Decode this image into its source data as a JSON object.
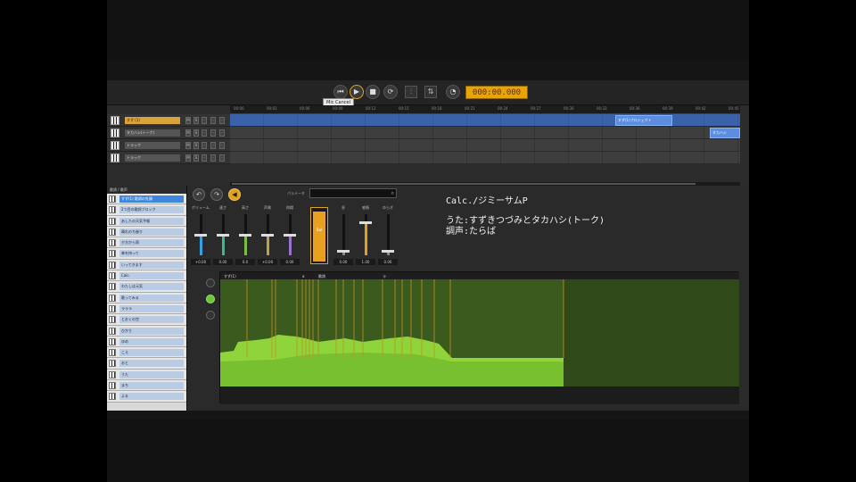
{
  "transport": {
    "tooltip": "Mic Cancel",
    "timecode": "000:00.000"
  },
  "tracks": {
    "ruler_ticks": [
      "00:00",
      "00:03",
      "00:06",
      "00:09",
      "00:12",
      "00:15",
      "00:18",
      "00:21",
      "00:24",
      "00:27",
      "00:30",
      "00:33",
      "00:36",
      "00:39",
      "00:42",
      "00:45"
    ],
    "rows": [
      {
        "name": "すず (1)",
        "selected": true
      },
      {
        "name": "タカハシ(トーク)",
        "selected": false
      },
      {
        "name": "トラック",
        "selected": false
      },
      {
        "name": "トラック",
        "selected": false
      }
    ],
    "clips": [
      {
        "label": "すず(1)プロジェクト",
        "track": 0
      },
      {
        "label": "タカハシ",
        "track": 1
      }
    ]
  },
  "lyrics": {
    "header": "歌詞 / 歌声",
    "rows": [
      "すず(1) 歌詞の先頭",
      "2つ目の歌詞ブロック",
      "あしたの天気予報",
      "晴れのち曇り",
      "夕方から雨",
      "傘を持って",
      "いってきます",
      "Calc.",
      "わたしは元気",
      "歌ってみる",
      "ラララ",
      "とおくの空",
      "ひかり",
      "ゆめ",
      "こえ",
      "おと",
      "うた",
      "まち",
      "よる"
    ]
  },
  "params": {
    "label": "パラメータ",
    "sliders": [
      {
        "label": "ボリューム",
        "value": "+0.00",
        "color": "#3aa0e0",
        "level": 0.5
      },
      {
        "label": "速さ",
        "value": "0.00",
        "color": "#30c090",
        "level": 0.5
      },
      {
        "label": "高さ",
        "value": "0.0",
        "color": "#7ac040",
        "level": 0.5
      },
      {
        "label": "声質",
        "value": "+0.00",
        "color": "#c0a040",
        "level": 0.5
      },
      {
        "label": "抑揚",
        "value": "0.00",
        "color": "#9a70d0",
        "level": 0.5
      }
    ],
    "bigbar_label": "Bal",
    "right_sliders": [
      {
        "label": "息",
        "value": "0.00",
        "color": "#888888",
        "level": 0.1
      },
      {
        "label": "感情",
        "value": "1.00",
        "color": "#e0a020",
        "level": 0.8
      },
      {
        "label": "ゆらぎ",
        "value": "0.00",
        "color": "#888888",
        "level": 0.1
      }
    ]
  },
  "credits": {
    "line1": "Calc./ジミーサムP",
    "line2": "うた:すずきつづみとタカハシ(トーク)",
    "line3": "調声:たらば"
  },
  "graph": {
    "header_labels": [
      "すず(1)",
      "a",
      "歌詞",
      "ラ"
    ],
    "colors": {
      "bright": "#8ed43a",
      "dark": "#3a5a1e",
      "marker": "#c89020"
    }
  }
}
